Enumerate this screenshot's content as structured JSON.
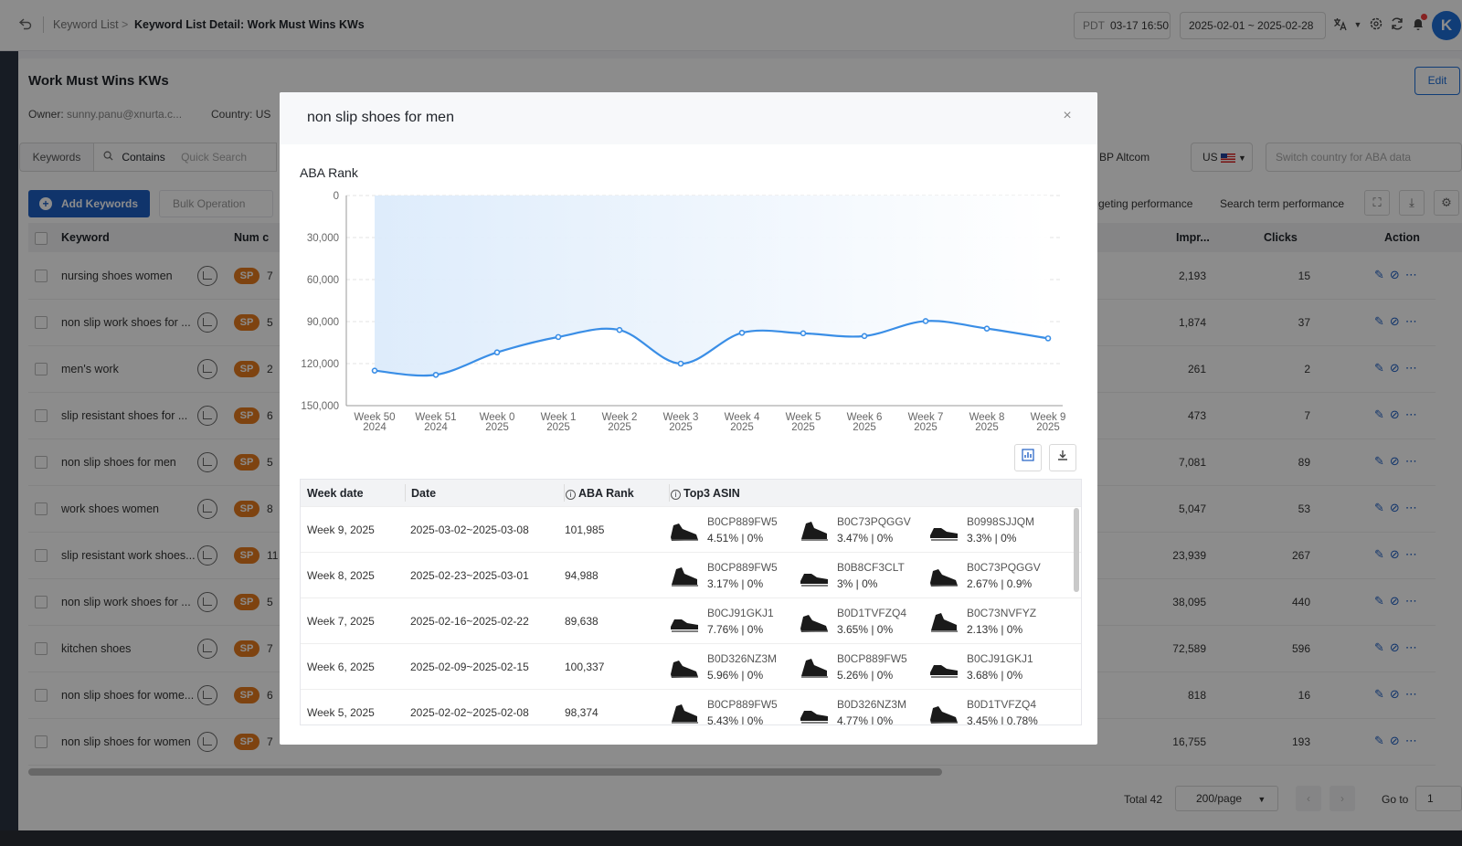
{
  "header": {
    "breadcrumb_root": "Keyword List",
    "breadcrumb_arrow": ">",
    "breadcrumb_current": "Keyword List Detail: Work Must Wins KWs",
    "timezone": "PDT",
    "time": "03-17 16:50",
    "date_range": "2025-02-01 ~ 2025-02-28",
    "avatar_letter": "K"
  },
  "detail": {
    "title": "Work Must Wins KWs",
    "owner_label": "Owner:",
    "owner_value": "sunny.panu@xnurta.c...",
    "country_label": "Country:",
    "country_value": "US",
    "edit_label": "Edit"
  },
  "filters": {
    "tab_label": "Keywords",
    "match_mode": "Contains",
    "search_placeholder": "Quick Search",
    "account": "BP Altcom",
    "country": "US",
    "switch_placeholder": "Switch country for ABA data"
  },
  "toolbar": {
    "add_label": "Add Keywords",
    "bulk_label": "Bulk Operation",
    "targeting_link": "geting performance",
    "search_term_link": "Search term performance"
  },
  "table": {
    "headers": {
      "keyword": "Keyword",
      "num": "Num c",
      "impr": "Impr...",
      "clicks": "Clicks",
      "action": "Action"
    },
    "rows": [
      {
        "keyword": "nursing shoes women",
        "badge": "SP",
        "num": "7",
        "impr": "2,193",
        "clicks": "15"
      },
      {
        "keyword": "non slip work shoes for ...",
        "badge": "SP",
        "num": "5",
        "impr": "1,874",
        "clicks": "37"
      },
      {
        "keyword": "men's work",
        "badge": "SP",
        "num": "2",
        "impr": "261",
        "clicks": "2"
      },
      {
        "keyword": "slip resistant shoes for ...",
        "badge": "SP",
        "num": "6",
        "impr": "473",
        "clicks": "7"
      },
      {
        "keyword": "non slip shoes for men",
        "badge": "SP",
        "num": "5",
        "impr": "7,081",
        "clicks": "89"
      },
      {
        "keyword": "work shoes women",
        "badge": "SP",
        "num": "8",
        "impr": "5,047",
        "clicks": "53"
      },
      {
        "keyword": "slip resistant work shoes...",
        "badge": "SP",
        "num": "11",
        "impr": "23,939",
        "clicks": "267"
      },
      {
        "keyword": "non slip work shoes for ...",
        "badge": "SP",
        "num": "5",
        "impr": "38,095",
        "clicks": "440"
      },
      {
        "keyword": "kitchen shoes",
        "badge": "SP",
        "num": "7",
        "impr": "72,589",
        "clicks": "596"
      },
      {
        "keyword": "non slip shoes for wome...",
        "badge": "SP",
        "num": "6",
        "impr": "818",
        "clicks": "16"
      },
      {
        "keyword": "non slip shoes for women",
        "badge": "SP",
        "num": "7",
        "impr": "16,755",
        "clicks": "193"
      }
    ]
  },
  "pager": {
    "total": "Total 42",
    "page_size": "200/page",
    "goto_label": "Go to",
    "page": "1"
  },
  "modal": {
    "title": "non slip shoes for men",
    "close": "×",
    "chart_label": "ABA Rank",
    "table_headers": {
      "week": "Week date",
      "date": "Date",
      "rank": "ABA Rank",
      "asin": "Top3 ASIN"
    },
    "rows": [
      {
        "week": "Week 9, 2025",
        "date": "2025-03-02~2025-03-08",
        "rank": "101,985",
        "asins": [
          {
            "code": "B0CP889FW5",
            "share": "4.51% | 0%"
          },
          {
            "code": "B0C73PQGGV",
            "share": "3.47% | 0%"
          },
          {
            "code": "B0998SJJQM",
            "share": "3.3% | 0%"
          }
        ]
      },
      {
        "week": "Week 8, 2025",
        "date": "2025-02-23~2025-03-01",
        "rank": "94,988",
        "asins": [
          {
            "code": "B0CP889FW5",
            "share": "3.17% | 0%"
          },
          {
            "code": "B0B8CF3CLT",
            "share": "3% | 0%"
          },
          {
            "code": "B0C73PQGGV",
            "share": "2.67% | 0.9%"
          }
        ]
      },
      {
        "week": "Week 7, 2025",
        "date": "2025-02-16~2025-02-22",
        "rank": "89,638",
        "asins": [
          {
            "code": "B0CJ91GKJ1",
            "share": "7.76% | 0%"
          },
          {
            "code": "B0D1TVFZQ4",
            "share": "3.65% | 0%"
          },
          {
            "code": "B0C73NVFYZ",
            "share": "2.13% | 0%"
          }
        ]
      },
      {
        "week": "Week 6, 2025",
        "date": "2025-02-09~2025-02-15",
        "rank": "100,337",
        "asins": [
          {
            "code": "B0D326NZ3M",
            "share": "5.96% | 0%"
          },
          {
            "code": "B0CP889FW5",
            "share": "5.26% | 0%"
          },
          {
            "code": "B0CJ91GKJ1",
            "share": "3.68% | 0%"
          }
        ]
      },
      {
        "week": "Week 5, 2025",
        "date": "2025-02-02~2025-02-08",
        "rank": "98,374",
        "asins": [
          {
            "code": "B0CP889FW5",
            "share": "5.43% | 0%"
          },
          {
            "code": "B0D326NZ3M",
            "share": "4.77% | 0%"
          },
          {
            "code": "B0D1TVFZQ4",
            "share": "3.45% | 0.78%"
          }
        ]
      }
    ]
  },
  "chart_data": {
    "type": "area",
    "title": "ABA Rank",
    "categories": [
      "Week 50 2024",
      "Week 51 2024",
      "Week 0 2025",
      "Week 1 2025",
      "Week 2 2025",
      "Week 3 2025",
      "Week 4 2025",
      "Week 5 2025",
      "Week 6 2025",
      "Week 7 2025",
      "Week 8 2025",
      "Week 9 2025"
    ],
    "category_lines": [
      [
        "Week 50",
        "2024"
      ],
      [
        "Week 51",
        "2024"
      ],
      [
        "Week 0",
        "2025"
      ],
      [
        "Week 1",
        "2025"
      ],
      [
        "Week 2",
        "2025"
      ],
      [
        "Week 3",
        "2025"
      ],
      [
        "Week 4",
        "2025"
      ],
      [
        "Week 5",
        "2025"
      ],
      [
        "Week 6",
        "2025"
      ],
      [
        "Week 7",
        "2025"
      ],
      [
        "Week 8",
        "2025"
      ],
      [
        "Week 9",
        "2025"
      ]
    ],
    "values": [
      125000,
      128000,
      112000,
      101000,
      96000,
      120000,
      98000,
      98374,
      100337,
      89638,
      94988,
      101985
    ],
    "ylim": [
      0,
      150000
    ],
    "y_inverted": true,
    "yticks": [
      "0",
      "30,000",
      "60,000",
      "90,000",
      "120,000",
      "150,000"
    ],
    "ytick_values": [
      0,
      30000,
      60000,
      90000,
      120000,
      150000
    ],
    "grid": true,
    "line_color": "#3a8ee6",
    "fill_color": "#dcebfb"
  },
  "colors": {
    "primary": "#1e5fc4",
    "badge": "#e57b1e",
    "avatar": "#1e6fd9"
  }
}
